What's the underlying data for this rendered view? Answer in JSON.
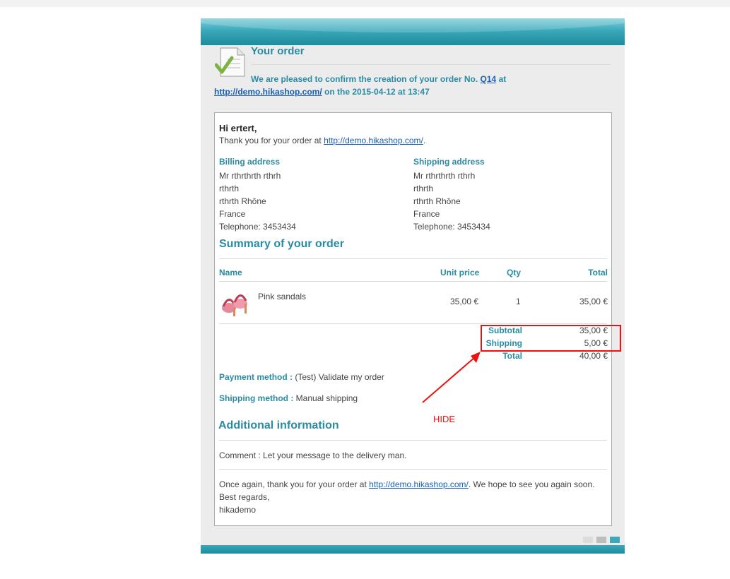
{
  "header": {
    "title": "Your order",
    "confirm_prefix": "We are pleased to confirm the creation of your order No.",
    "order_number": "Q14",
    "at": "at",
    "site_url": "http://demo.hikashop.com/",
    "date_text": "on the 2015-04-12 at 13:47"
  },
  "greeting": {
    "hi": "Hi ertert,",
    "thanks_prefix": "Thank you for your order at",
    "thanks_url": "http://demo.hikashop.com/",
    "thanks_suffix": "."
  },
  "billing": {
    "label": "Billing address",
    "lines": [
      "Mr rthrthrth rthrh",
      "rthrth",
      "rthrth Rhône",
      "France",
      "Telephone: 3453434"
    ]
  },
  "shipping": {
    "label": "Shipping address",
    "lines": [
      "Mr rthrthrth rthrh",
      "rthrth",
      "rthrth Rhône",
      "France",
      "Telephone: 3453434"
    ]
  },
  "summary": {
    "title": "Summary of your order",
    "columns": {
      "name": "Name",
      "unit_price": "Unit price",
      "qty": "Qty",
      "total": "Total"
    },
    "items": [
      {
        "name": "Pink sandals",
        "unit_price": "35,00 €",
        "qty": "1",
        "total": "35,00 €",
        "icon": "pink-sandals-image"
      }
    ],
    "subtotal_label": "Subtotal",
    "subtotal_value": "35,00 €",
    "shipping_label": "Shipping",
    "shipping_value": "5,00 €",
    "total_label": "Total",
    "total_value": "40,00 €"
  },
  "payment": {
    "label": "Payment method :",
    "value": "(Test) Validate my order"
  },
  "shipping_method": {
    "label": "Shipping method :",
    "value": "Manual shipping"
  },
  "additional": {
    "title": "Additional information",
    "comment": "Comment : Let your message to the delivery man."
  },
  "closing": {
    "prefix": "Once again, thank you for your order at",
    "url": "http://demo.hikashop.com/",
    "suffix": ". We hope to see you again soon.",
    "regards": "Best regards,",
    "signature": "hikademo"
  },
  "annotation": {
    "text": "HIDE",
    "color": "#e11111"
  },
  "colors": {
    "accent": "#2a8ba3",
    "link": "#1a5fb4",
    "band": "#3aa9b9"
  }
}
